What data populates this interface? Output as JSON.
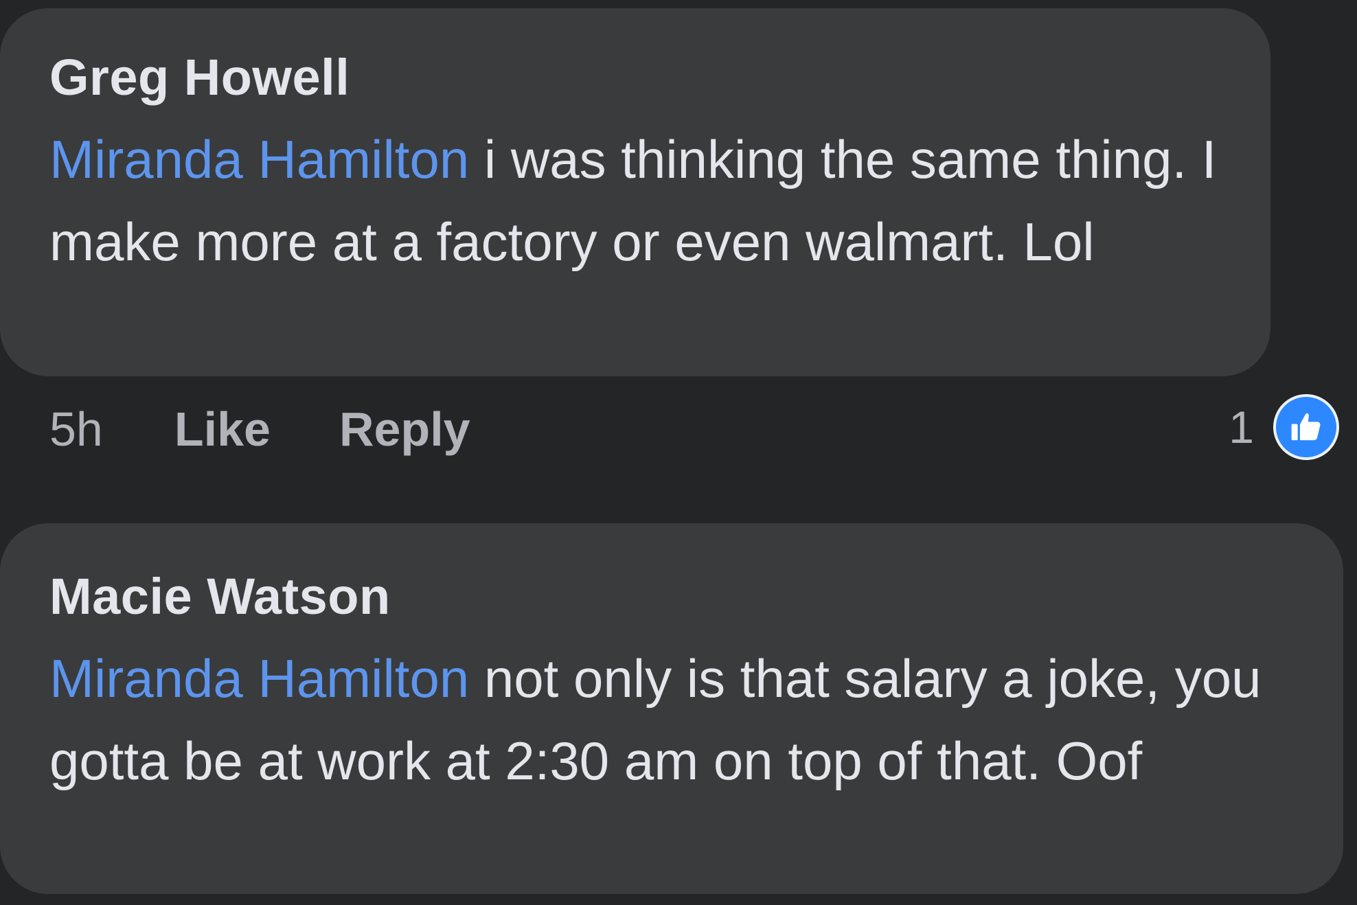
{
  "comments": [
    {
      "author": "Greg Howell",
      "mention": "Miranda Hamilton",
      "text": " i was thinking the same thing. I make more at a factory or even walmart. Lol",
      "time": "5h",
      "like_label": "Like",
      "reply_label": "Reply",
      "reaction_count": "1",
      "reaction_icon": "thumbs-up-icon",
      "reaction_color": "#2d88ff"
    },
    {
      "author": "Macie Watson",
      "mention": "Miranda Hamilton",
      "text": " not only is that salary a joke, you gotta be at work at 2:30 am on top of that. Oof"
    }
  ],
  "colors": {
    "background": "#242526",
    "bubble": "#3a3b3c",
    "text": "#e4e6eb",
    "mention": "#5d95ee",
    "secondary_text": "#b0b3b8"
  }
}
